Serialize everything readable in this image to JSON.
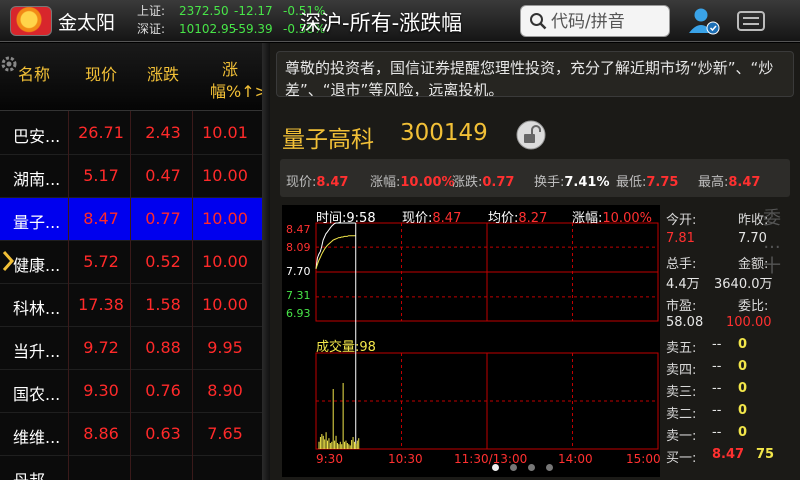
{
  "app": {
    "name": "金太阳",
    "screen_title": "深沪-所有-涨跌幅"
  },
  "indices": [
    {
      "label": "上证:",
      "value": "2372.50",
      "change": "-12.17",
      "percent": "-0.51%"
    },
    {
      "label": "深证:",
      "value": "10102.95",
      "change": "-59.39",
      "percent": "-0.58%"
    }
  ],
  "search": {
    "placeholder": "代码/拼音"
  },
  "icons": {
    "logo": "sun-logo-icon",
    "search": "search-icon",
    "user": "user-account-icon",
    "menu": "menu-icon",
    "settings": "gear-icon",
    "lock": "lock-icon"
  },
  "colors": {
    "up": "#ff3030",
    "down": "#48e548",
    "accent": "#f2c037",
    "selected_row": "#0000ee"
  },
  "list": {
    "headers": [
      "名称",
      "现价",
      "涨跌",
      "涨幅%↑>"
    ],
    "rows": [
      {
        "name": "巴安...",
        "price": "26.71",
        "change": "2.43",
        "percent": "10.01"
      },
      {
        "name": "湖南...",
        "price": "5.17",
        "change": "0.47",
        "percent": "10.00"
      },
      {
        "name": "量子...",
        "price": "8.47",
        "change": "0.77",
        "percent": "10.00",
        "selected": true
      },
      {
        "name": "健康...",
        "price": "5.72",
        "change": "0.52",
        "percent": "10.00"
      },
      {
        "name": "科林...",
        "price": "17.38",
        "change": "1.58",
        "percent": "10.00"
      },
      {
        "name": "当升...",
        "price": "9.72",
        "change": "0.88",
        "percent": "9.95"
      },
      {
        "name": "国农...",
        "price": "9.30",
        "change": "0.76",
        "percent": "8.90"
      },
      {
        "name": "维维...",
        "price": "8.86",
        "change": "0.63",
        "percent": "7.65"
      },
      {
        "name": "丹邦",
        "price": "",
        "change": "",
        "percent": ""
      }
    ]
  },
  "notice": {
    "text": "尊敬的投资者，国信证券提醒您理性投资，充分了解近期市场“炒新”、“炒差”、“退市”等风险，远离投机。"
  },
  "stock": {
    "name": "量子高科",
    "code": "300149",
    "quote": [
      {
        "label": "现价:",
        "value": "8.47"
      },
      {
        "label": "涨幅:",
        "value": "10.00%"
      },
      {
        "label": "涨跌:",
        "value": "0.77"
      },
      {
        "label": "换手:",
        "value": "7.41%"
      },
      {
        "label": "最低:",
        "value": "7.75"
      },
      {
        "label": "最高:",
        "value": "8.47"
      }
    ]
  },
  "chart_header": {
    "time_label": "时间:",
    "time_value": "9:58",
    "price_label": "现价:",
    "price_value": "8.47",
    "avg_label": "均价:",
    "avg_value": "8.27",
    "pct_label": "涨幅:",
    "pct_value": "10.00%"
  },
  "chart_data": {
    "type": "line",
    "y_ticks": [
      "8.47",
      "8.09",
      "7.70",
      "7.31",
      "6.93"
    ],
    "x_ticks": [
      "9:30",
      "10:30",
      "11:30/13:00",
      "14:00",
      "15:00"
    ],
    "ylim": [
      6.93,
      8.47
    ],
    "series": [
      {
        "values": [
          7.75,
          7.92,
          7.98,
          8.02,
          8.1,
          8.2,
          8.25,
          8.3,
          8.33,
          8.36,
          8.39,
          8.42,
          8.44,
          8.46,
          8.47,
          8.47,
          8.47,
          8.47,
          8.47,
          8.47,
          8.47,
          8.47,
          8.47,
          8.47,
          8.47,
          8.47,
          8.47,
          8.47,
          8.47
        ]
      },
      {
        "values": [
          7.75,
          7.82,
          7.88,
          7.93,
          7.98,
          8.02,
          8.06,
          8.09,
          8.12,
          8.14,
          8.16,
          8.18,
          8.2,
          8.21,
          8.22,
          8.23,
          8.24,
          8.24,
          8.25,
          8.25,
          8.26,
          8.26,
          8.26,
          8.27,
          8.27,
          8.27,
          8.27,
          8.27,
          8.27
        ]
      }
    ],
    "volume_label": "成交量:",
    "volume_value": "98",
    "volume": [
      12,
      20,
      25,
      22,
      16,
      28,
      14,
      18,
      10,
      12,
      100,
      14,
      22,
      10,
      8,
      12,
      8,
      110,
      12,
      14,
      10,
      8,
      6,
      15,
      20,
      12,
      9,
      14,
      18
    ]
  },
  "side": {
    "open_label": "今开:",
    "open_value": "7.81",
    "prev_label": "昨收:",
    "prev_value": "7.70",
    "vol_label": "总手:",
    "vol_value": "4.4万",
    "amt_label": "金额:",
    "amt_value": "3640.0万",
    "pe_label": "市盈:",
    "pe_value": "58.08",
    "ratio_label": "委比:",
    "ratio_value": "100.00",
    "book": [
      {
        "label": "卖五:",
        "price": "--",
        "qty": "0"
      },
      {
        "label": "卖四:",
        "price": "--",
        "qty": "0"
      },
      {
        "label": "卖三:",
        "price": "--",
        "qty": "0"
      },
      {
        "label": "卖二:",
        "price": "--",
        "qty": "0"
      },
      {
        "label": "卖一:",
        "price": "--",
        "qty": "0"
      },
      {
        "label": "买一:",
        "price": "8.47",
        "qty": "75"
      }
    ],
    "tab_label": "委 ... 十"
  }
}
